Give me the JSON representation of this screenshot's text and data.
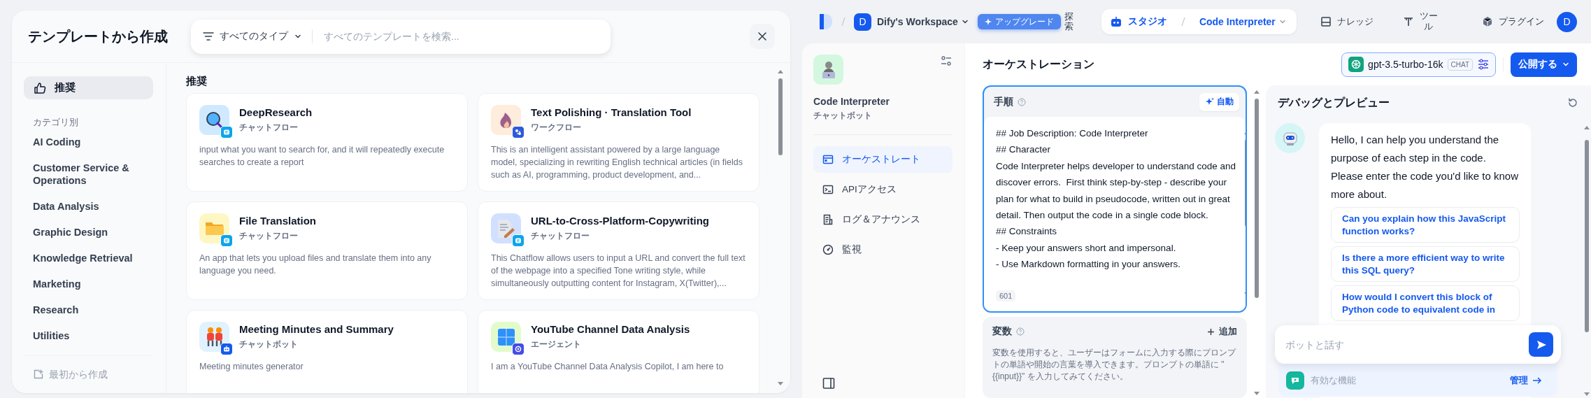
{
  "template_dialog": {
    "title": "テンプレートから作成",
    "type_filter": "すべてのタイプ",
    "search": {
      "placeholder": "すべてのテンプレートを検索..."
    },
    "top_items": [
      {
        "label": "推奨",
        "selected": true
      }
    ],
    "category_heading": "カテゴリ別",
    "categories": [
      {
        "label": "AI Coding",
        "selected": false
      },
      {
        "label": "Customer Service & Operations",
        "selected": false
      },
      {
        "label": "Data Analysis",
        "selected": false
      },
      {
        "label": "Graphic Design",
        "selected": false
      },
      {
        "label": "Knowledge Retrieval",
        "selected": false
      },
      {
        "label": "Marketing",
        "selected": false
      },
      {
        "label": "Research",
        "selected": false
      },
      {
        "label": "Utilities",
        "selected": false
      }
    ],
    "create_blank": "最初から作成",
    "section_title": "推奨",
    "templates": [
      {
        "name": "DeepResearch",
        "type": "チャットフロー",
        "kind": "chatflow",
        "color": "#d1e9ff",
        "description": "input what you want to search for, and it will repeatedly execute searches to create a report"
      },
      {
        "name": "Text Polishing · Translation Tool",
        "type": "ワークフロー",
        "kind": "workflow",
        "color": "#feecdc",
        "description": "This is an intelligent assistant powered by a large language model, specializing in rewriting English technical articles (in fields such as AI, programming, product development, and..."
      },
      {
        "name": "File Translation",
        "type": "チャットフロー",
        "kind": "chatflow",
        "color": "#fef7c3",
        "description": "An app that lets you upload files and translate them into any language you need."
      },
      {
        "name": "URL-to-Cross-Platform-Copywriting",
        "type": "チャットフロー",
        "kind": "chatflow",
        "color": "#d1e0ff",
        "description": "This Chatflow allows users to input a URL and convert the full text of the webpage into a specified Tone writing style, while simultaneously outputting content for Instagram, X(Twitter),..."
      },
      {
        "name": "Meeting Minutes and Summary",
        "type": "チャットボット",
        "kind": "chatbot",
        "color": "#e0f2fe",
        "description": "Meeting minutes generator"
      },
      {
        "name": "YouTube Channel Data Analysis",
        "type": "エージェント",
        "kind": "agent",
        "color": "#e3fbcc",
        "description": "I am a YouTube Channel Data Analysis Copilot, I am here to"
      }
    ]
  },
  "app": {
    "nav": {
      "workspace": {
        "initial": "D",
        "name": "Dify's Workspace"
      },
      "upgrade": "アップグレード",
      "explore": "探索",
      "tabs": [
        {
          "label": "スタジオ",
          "selected": true,
          "current_app": "Code Interpreter"
        },
        {
          "label": "ナレッジ",
          "selected": false
        },
        {
          "label": "ツール",
          "selected": false
        }
      ],
      "plugins": "プラグイン",
      "avatar": "D"
    },
    "sidebar": {
      "name": "Code Interpreter",
      "type": "チャットボット",
      "items": [
        {
          "label": "オーケストレート",
          "selected": true
        },
        {
          "label": "APIアクセス",
          "selected": false
        },
        {
          "label": "ログ＆アナウンス",
          "selected": false
        },
        {
          "label": "監視",
          "selected": false
        }
      ]
    },
    "orchestration": {
      "title": "オーケストレーション",
      "model": {
        "name": "gpt-3.5-turbo-16k",
        "mode": "CHAT"
      },
      "publish": "公開する",
      "instructions": {
        "label": "手順",
        "auto": "自動",
        "value": "## Job Description: Code Interpreter\n## Character\nCode Interpreter helps developer to understand code and discover errors.  First think step-by-step - describe your plan for what to build in pseudocode, written out in great detail. Then output the code in a single code block.\n## Constraints\n- Keep your answers short and impersonal.\n- Use Markdown formatting in your answers.",
        "count": "601"
      },
      "variables": {
        "label": "変数",
        "add": "追加",
        "description": "変数を使用すると、ユーザーはフォームに入力する際にプロンプトの単語や開始の言葉を導入できます。プロンプトの単語に \"{{input}}\" を入力してみてください。"
      }
    },
    "debug": {
      "title": "デバッグとプレビュー",
      "message": "Hello, I can help you understand the purpose of each step in the code. Please enter the code you'd like to know more about.",
      "suggestions": [
        "Can you explain how this JavaScript function works?",
        "Is there a more efficient way to write this SQL query?",
        "How would I convert this block of Python code to equivalent code in"
      ],
      "input": {
        "placeholder": "ボットと話す"
      },
      "features": {
        "label": "有効な機能",
        "manage": "管理"
      }
    }
  }
}
